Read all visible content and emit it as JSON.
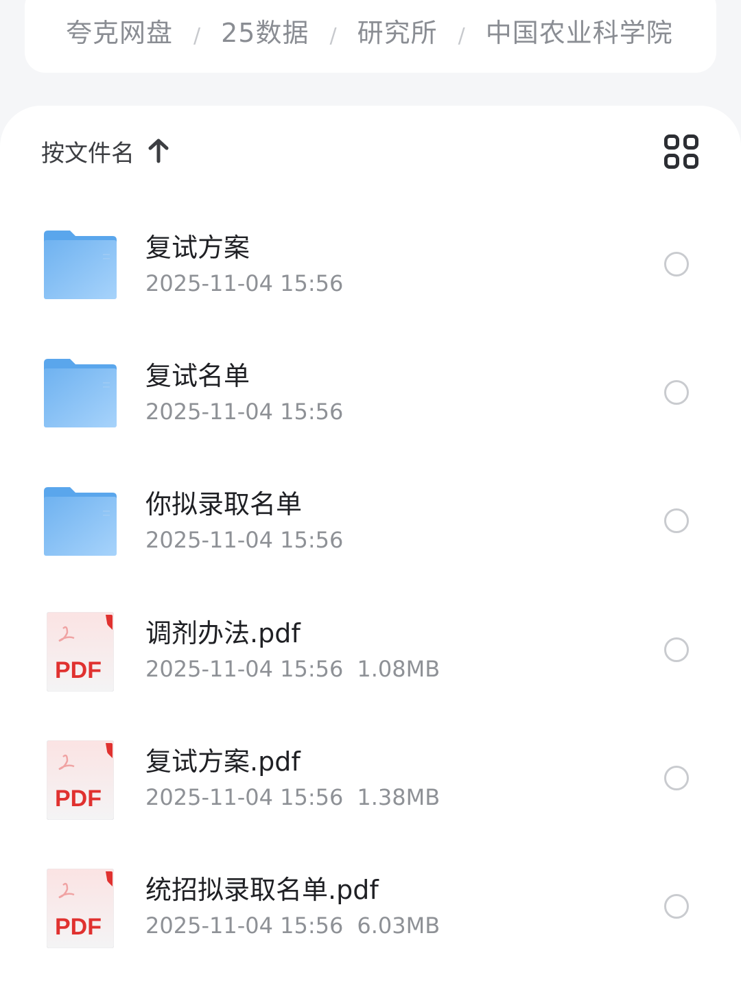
{
  "breadcrumb": {
    "items": [
      "夸克网盘",
      "25数据",
      "研究所",
      "中国农业科学院"
    ],
    "separator": "/"
  },
  "toolbar": {
    "sort_label": "按文件名",
    "sort_icon": "arrow-up-icon",
    "view_toggle_icon": "grid-view-icon"
  },
  "files": [
    {
      "type": "folder",
      "name": "复试方案",
      "date": "2025-11-04 15:56",
      "size": ""
    },
    {
      "type": "folder",
      "name": "复试名单",
      "date": "2025-11-04 15:56",
      "size": ""
    },
    {
      "type": "folder",
      "name": "你拟录取名单",
      "date": "2025-11-04 15:56",
      "size": ""
    },
    {
      "type": "pdf",
      "name": "调剂办法.pdf",
      "date": "2025-11-04 15:56",
      "size": "1.08MB"
    },
    {
      "type": "pdf",
      "name": "复试方案.pdf",
      "date": "2025-11-04 15:56",
      "size": "1.38MB"
    },
    {
      "type": "pdf",
      "name": "统招拟录取名单.pdf",
      "date": "2025-11-04 15:56",
      "size": "6.03MB"
    }
  ],
  "pdf_badge": "PDF",
  "colors": {
    "folder": "#7fbcf3",
    "pdf_red": "#e0312f",
    "text_primary": "#1f2024",
    "text_secondary": "#8e9196"
  }
}
